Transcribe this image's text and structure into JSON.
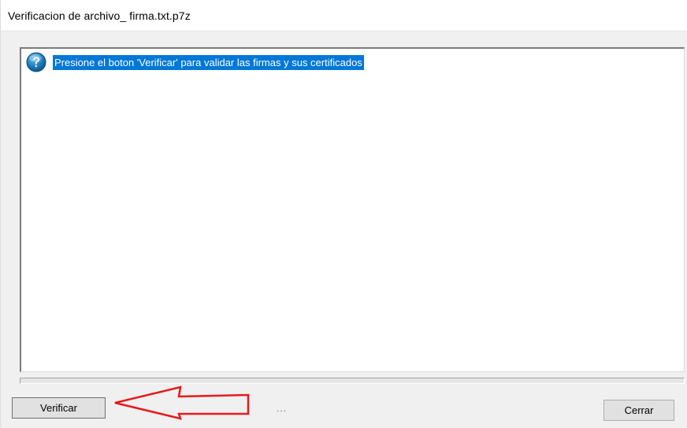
{
  "window": {
    "title": "Verificacion de archivo_ firma.txt.p7z"
  },
  "list": {
    "items": [
      {
        "icon": "question-icon",
        "label": "Presione el boton 'Verificar' para validar las firmas y sus certificados",
        "selected": true
      }
    ]
  },
  "progress": {
    "value": 0
  },
  "status": {
    "text": "..."
  },
  "buttons": {
    "verify_label": "Verificar",
    "close_label": "Cerrar"
  },
  "annotation": {
    "arrow": "red-arrow-pointing-left",
    "color": "#e8191c"
  },
  "colors": {
    "selection": "#0078d7",
    "icon": "#1b76b3"
  }
}
